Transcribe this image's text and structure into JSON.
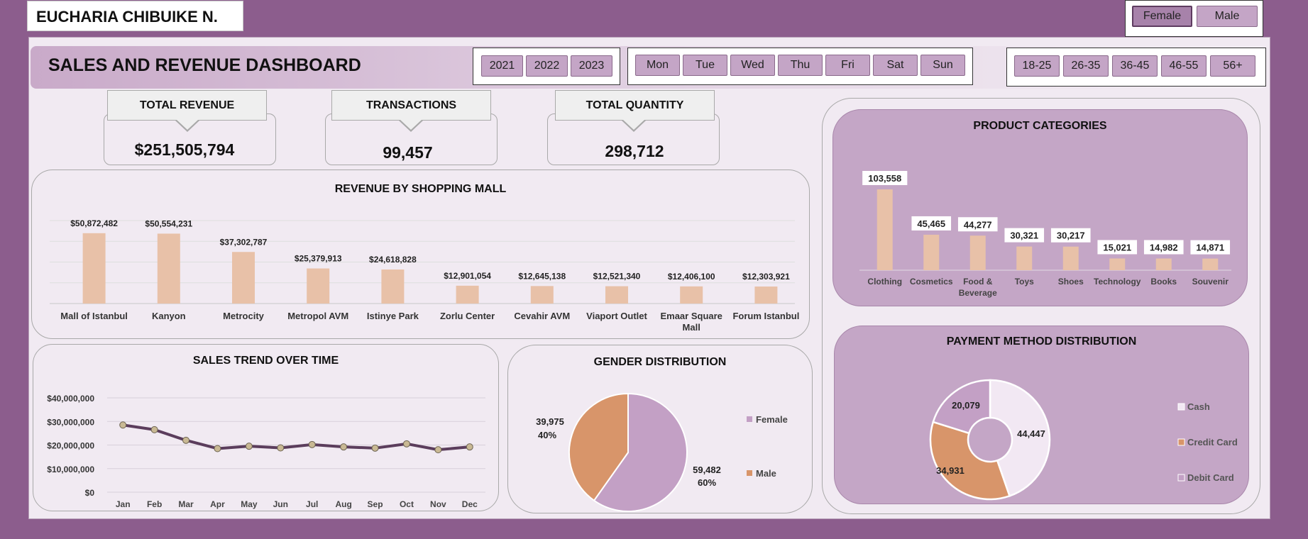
{
  "author": "EUCHARIA CHIBUIKE N.",
  "gender_slicer": [
    {
      "label": "Female",
      "selected": true
    },
    {
      "label": "Male",
      "selected": false
    }
  ],
  "dashboard_title": "SALES AND REVENUE DASHBOARD",
  "year_slicer": [
    "2021",
    "2022",
    "2023"
  ],
  "day_slicer": [
    "Mon",
    "Tue",
    "Wed",
    "Thu",
    "Fri",
    "Sat",
    "Sun"
  ],
  "age_slicer": [
    "18-25",
    "26-35",
    "36-45",
    "46-55",
    "56+"
  ],
  "kpis": {
    "revenue": {
      "label": "TOTAL REVENUE",
      "value": "$251,505,794"
    },
    "transactions": {
      "label": "TRANSACTIONS",
      "value": "99,457"
    },
    "quantity": {
      "label": "TOTAL QUANTITY",
      "value": "298,712"
    }
  },
  "colors": {
    "bar": "#e8c1a8",
    "line": "#5b3d5c",
    "female": "#c3a0c5",
    "male": "#d8956a",
    "cash": "#f2e8f3",
    "credit_card": "#d8956a",
    "debit_card": "#c3a0c5"
  },
  "chart_data": [
    {
      "id": "mall",
      "type": "bar",
      "title": "REVENUE BY SHOPPING MALL",
      "categories": [
        "Mall of Istanbul",
        "Kanyon",
        "Metrocity",
        "Metropol AVM",
        "Istinye Park",
        "Zorlu Center",
        "Cevahir AVM",
        "Viaport Outlet",
        "Emaar Square Mall",
        "Forum Istanbul"
      ],
      "values": [
        50872482,
        50554231,
        37302787,
        25379913,
        24618828,
        12901054,
        12645138,
        12521340,
        12406100,
        12303921
      ],
      "data_labels": [
        "$50,872,482",
        "$50,554,231",
        "$37,302,787",
        "$25,379,913",
        "$24,618,828",
        "$12,901,054",
        "$12,645,138",
        "$12,521,340",
        "$12,406,100",
        "$12,303,921"
      ],
      "ylim": [
        0,
        60000000
      ],
      "grid": true
    },
    {
      "id": "categories",
      "type": "bar",
      "title": "PRODUCT CATEGORIES",
      "categories": [
        "Clothing",
        "Cosmetics",
        "Food & Beverage",
        "Toys",
        "Shoes",
        "Technology",
        "Books",
        "Souvenir"
      ],
      "values": [
        103558,
        45465,
        44277,
        30321,
        30217,
        15021,
        14982,
        14871
      ],
      "data_labels": [
        "103,558",
        "45,465",
        "44,277",
        "30,321",
        "30,217",
        "15,021",
        "14,982",
        "14,871"
      ],
      "ylim": [
        0,
        110000
      ],
      "grid": false
    },
    {
      "id": "trend",
      "type": "line",
      "title": "SALES TREND OVER TIME",
      "categories": [
        "Jan",
        "Feb",
        "Mar",
        "Apr",
        "May",
        "Jun",
        "Jul",
        "Aug",
        "Sep",
        "Oct",
        "Nov",
        "Dec"
      ],
      "values": [
        28500000,
        26500000,
        22000000,
        18500000,
        19500000,
        18800000,
        20200000,
        19200000,
        18700000,
        20500000,
        18000000,
        19200000
      ],
      "y_ticks": [
        "$0",
        "$10,000,000",
        "$20,000,000",
        "$30,000,000",
        "$40,000,000"
      ],
      "ylim": [
        0,
        40000000
      ],
      "grid": true
    },
    {
      "id": "gender",
      "type": "pie",
      "title": "GENDER DISTRIBUTION",
      "series": [
        {
          "name": "Female",
          "value": 59482,
          "label": "59,482",
          "percent": "60%"
        },
        {
          "name": "Male",
          "value": 39975,
          "label": "39,975",
          "percent": "40%"
        }
      ],
      "legend": "right"
    },
    {
      "id": "payment",
      "type": "pie",
      "title": "PAYMENT METHOD DISTRIBUTION",
      "series": [
        {
          "name": "Cash",
          "value": 44447,
          "label": "44,447"
        },
        {
          "name": "Credit Card",
          "value": 34931,
          "label": "34,931"
        },
        {
          "name": "Debit Card",
          "value": 20079,
          "label": "20,079"
        }
      ],
      "legend": "right"
    }
  ]
}
